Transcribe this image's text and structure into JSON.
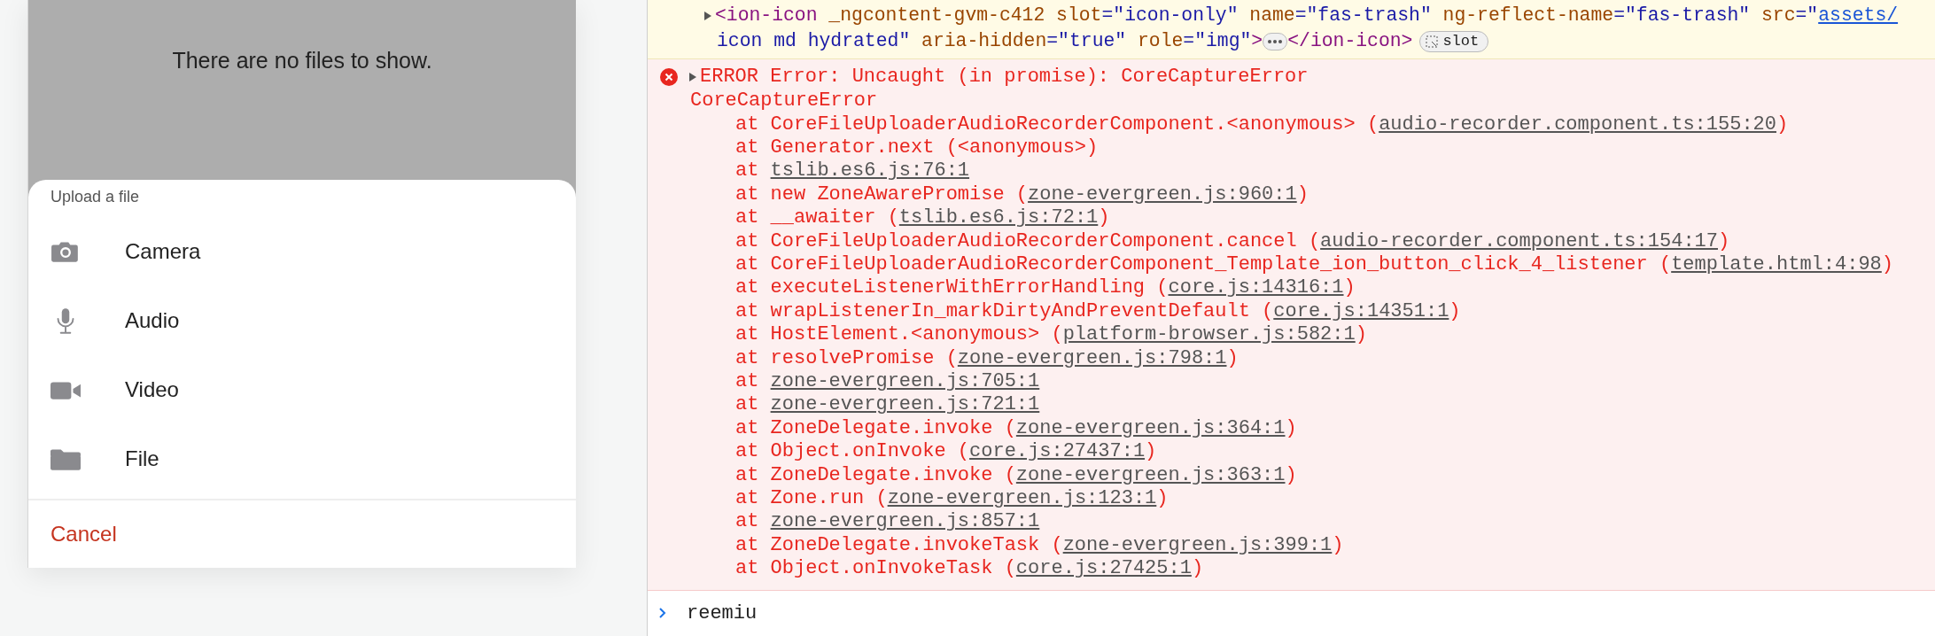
{
  "phone": {
    "empty_message": "There are no files to show.",
    "action_sheet": {
      "title": "Upload a file",
      "items": [
        {
          "kind": "camera",
          "label": "Camera"
        },
        {
          "kind": "audio",
          "label": "Audio"
        },
        {
          "kind": "video",
          "label": "Video"
        },
        {
          "kind": "file",
          "label": "File"
        }
      ],
      "cancel": "Cancel"
    }
  },
  "console": {
    "element": {
      "expanded": false,
      "line_1": [
        {
          "kind": "tag",
          "text": "<ion-icon"
        },
        {
          "kind": "attr",
          "text": " _ngcontent-gvm-c412"
        },
        {
          "kind": "attr",
          "text": " slot"
        },
        {
          "kind": "value",
          "text": "=\"icon-only\""
        },
        {
          "kind": "attr",
          "text": " name"
        },
        {
          "kind": "value",
          "text": "=\"fas-trash\""
        },
        {
          "kind": "attr",
          "text": " ng-reflect-name"
        },
        {
          "kind": "value",
          "text": "=\"fas-trash\""
        },
        {
          "kind": "attr",
          "text": " src"
        },
        {
          "kind": "value",
          "text": "=\""
        }
      ],
      "link": "assets/",
      "line_2": [
        {
          "kind": "value",
          "text": "icon md hydrated\""
        },
        {
          "kind": "attr",
          "text": " aria-hidden"
        },
        {
          "kind": "value",
          "text": "=\"true\""
        },
        {
          "kind": "attr",
          "text": " role"
        },
        {
          "kind": "value",
          "text": "=\"img\""
        },
        {
          "kind": "tag",
          "text": ">"
        }
      ],
      "line_2_end": [
        {
          "kind": "tag",
          "text": "</ion-icon>"
        }
      ],
      "badge": "slot"
    },
    "error": {
      "expanded": false,
      "message": "ERROR Error: Uncaught (in promise): CoreCaptureError",
      "name": "CoreCaptureError",
      "stack": [
        {
          "text": "at CoreFileUploaderAudioRecorderComponent.<anonymous> (",
          "link": "audio-recorder.component.ts:155:20",
          "end": ")"
        },
        {
          "text": "at Generator.next (<anonymous>)"
        },
        {
          "text": "at ",
          "link": "tslib.es6.js:76:1"
        },
        {
          "text": "at new ZoneAwarePromise (",
          "link": "zone-evergreen.js:960:1",
          "end": ")"
        },
        {
          "text": "at __awaiter (",
          "link": "tslib.es6.js:72:1",
          "end": ")"
        },
        {
          "text": "at CoreFileUploaderAudioRecorderComponent.cancel (",
          "link": "audio-recorder.component.ts:154:17",
          "end": ")"
        },
        {
          "text": "at CoreFileUploaderAudioRecorderComponent_Template_ion_button_click_4_listener (",
          "link": "template.html:4:98",
          "end": ")"
        },
        {
          "text": "at executeListenerWithErrorHandling (",
          "link": "core.js:14316:1",
          "end": ")"
        },
        {
          "text": "at wrapListenerIn_markDirtyAndPreventDefault (",
          "link": "core.js:14351:1",
          "end": ")"
        },
        {
          "text": "at HostElement.<anonymous> (",
          "link": "platform-browser.js:582:1",
          "end": ")"
        },
        {
          "text": "at resolvePromise (",
          "link": "zone-evergreen.js:798:1",
          "end": ")"
        },
        {
          "text": "at ",
          "link": "zone-evergreen.js:705:1"
        },
        {
          "text": "at ",
          "link": "zone-evergreen.js:721:1"
        },
        {
          "text": "at ZoneDelegate.invoke (",
          "link": "zone-evergreen.js:364:1",
          "end": ")"
        },
        {
          "text": "at Object.onInvoke (",
          "link": "core.js:27437:1",
          "end": ")"
        },
        {
          "text": "at ZoneDelegate.invoke (",
          "link": "zone-evergreen.js:363:1",
          "end": ")"
        },
        {
          "text": "at Zone.run (",
          "link": "zone-evergreen.js:123:1",
          "end": ")"
        },
        {
          "text": "at ",
          "link": "zone-evergreen.js:857:1"
        },
        {
          "text": "at ZoneDelegate.invokeTask (",
          "link": "zone-evergreen.js:399:1",
          "end": ")"
        },
        {
          "text": "at Object.onInvokeTask (",
          "link": "core.js:27425:1",
          "end": ")"
        }
      ]
    },
    "prompt": {
      "value": "reemiu"
    }
  }
}
